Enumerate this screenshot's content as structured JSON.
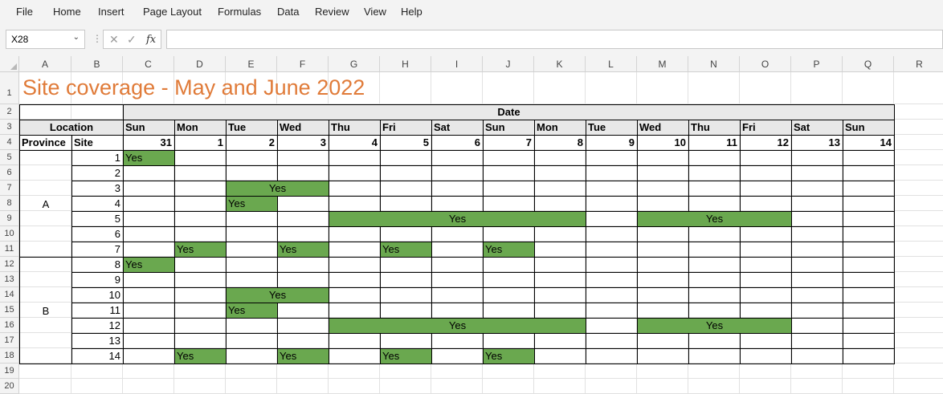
{
  "menu": [
    "File",
    "Home",
    "Insert",
    "Page Layout",
    "Formulas",
    "Data",
    "Review",
    "View",
    "Help"
  ],
  "formula_bar": {
    "name_box": "X28",
    "formula": "",
    "fx_label": "fx",
    "cancel_icon": "✕",
    "enter_icon": "✓"
  },
  "columns": [
    "A",
    "B",
    "C",
    "D",
    "E",
    "F",
    "G",
    "H",
    "I",
    "J",
    "K",
    "L",
    "M",
    "N",
    "O",
    "P",
    "Q",
    "R"
  ],
  "rows": [
    "1",
    "2",
    "3",
    "4",
    "5",
    "6",
    "7",
    "8",
    "9",
    "10",
    "11",
    "12",
    "13",
    "14",
    "15",
    "16",
    "17",
    "18",
    "19",
    "20"
  ],
  "sheet": {
    "title": "Site coverage - May and June 2022",
    "date_header": "Date",
    "location_header": "Location",
    "province_header": "Province",
    "site_header": "Site",
    "days": [
      "Sun",
      "Mon",
      "Tue",
      "Wed",
      "Thu",
      "Fri",
      "Sat",
      "Sun",
      "Mon",
      "Tue",
      "Wed",
      "Thu",
      "Fri",
      "Sat",
      "Sun"
    ],
    "dates": [
      "31",
      "1",
      "2",
      "3",
      "4",
      "5",
      "6",
      "7",
      "8",
      "9",
      "10",
      "11",
      "12",
      "13",
      "14"
    ],
    "provinces": [
      "A",
      "B"
    ],
    "sites": [
      "1",
      "2",
      "3",
      "4",
      "5",
      "6",
      "7",
      "8",
      "9",
      "10",
      "11",
      "12",
      "13",
      "14"
    ],
    "coverage": [
      {
        "site_index": 0,
        "start": 0,
        "span": 1,
        "text": "Yes",
        "align": "left"
      },
      {
        "site_index": 2,
        "start": 2,
        "span": 2,
        "text": "Yes",
        "align": "center"
      },
      {
        "site_index": 3,
        "start": 2,
        "span": 1,
        "text": "Yes",
        "align": "left"
      },
      {
        "site_index": 4,
        "start": 4,
        "span": 5,
        "text": "Yes",
        "align": "center"
      },
      {
        "site_index": 4,
        "start": 10,
        "span": 3,
        "text": "Yes",
        "align": "center"
      },
      {
        "site_index": 6,
        "start": 1,
        "span": 1,
        "text": "Yes",
        "align": "left"
      },
      {
        "site_index": 6,
        "start": 3,
        "span": 1,
        "text": "Yes",
        "align": "left"
      },
      {
        "site_index": 6,
        "start": 5,
        "span": 1,
        "text": "Yes",
        "align": "left"
      },
      {
        "site_index": 6,
        "start": 7,
        "span": 1,
        "text": "Yes",
        "align": "left"
      },
      {
        "site_index": 7,
        "start": 0,
        "span": 1,
        "text": "Yes",
        "align": "left"
      },
      {
        "site_index": 9,
        "start": 2,
        "span": 2,
        "text": "Yes",
        "align": "center"
      },
      {
        "site_index": 10,
        "start": 2,
        "span": 1,
        "text": "Yes",
        "align": "left"
      },
      {
        "site_index": 11,
        "start": 4,
        "span": 5,
        "text": "Yes",
        "align": "center"
      },
      {
        "site_index": 11,
        "start": 10,
        "span": 3,
        "text": "Yes",
        "align": "center"
      },
      {
        "site_index": 13,
        "start": 1,
        "span": 1,
        "text": "Yes",
        "align": "left"
      },
      {
        "site_index": 13,
        "start": 3,
        "span": 1,
        "text": "Yes",
        "align": "left"
      },
      {
        "site_index": 13,
        "start": 5,
        "span": 1,
        "text": "Yes",
        "align": "left"
      },
      {
        "site_index": 13,
        "start": 7,
        "span": 1,
        "text": "Yes",
        "align": "left"
      }
    ]
  },
  "colors": {
    "title": "#e07b39",
    "coverage_fill": "#6aa84f",
    "header_fill": "#e8e8e8"
  }
}
